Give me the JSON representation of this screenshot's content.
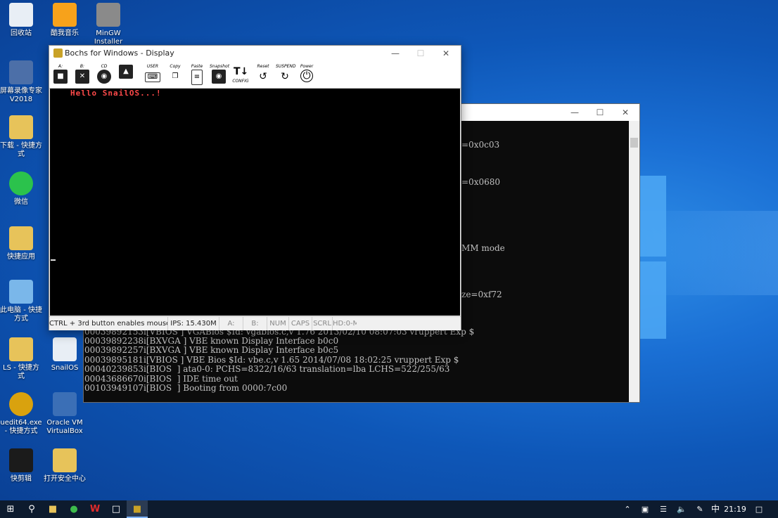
{
  "desktop_icons": [
    {
      "label": "回收站",
      "icon": "recycle-bin-icon"
    },
    {
      "label": "酷我音乐",
      "icon": "kuwo-music-icon"
    },
    {
      "label": "MinGW Installer",
      "icon": "mingw-installer-icon"
    },
    {
      "label": "屏幕录像专家 V2018",
      "icon": "screen-recorder-icon"
    },
    {
      "label": "下载 - 快捷方式",
      "icon": "folder-shortcut-icon"
    },
    {
      "label": "微信",
      "icon": "wechat-icon"
    },
    {
      "label": "快捷应用",
      "icon": "folder-shortcut-icon"
    },
    {
      "label": "此电脑 - 快捷方式",
      "icon": "this-pc-icon"
    },
    {
      "label": "LS - 快捷方式",
      "icon": "folder-shortcut-icon"
    },
    {
      "label": "SnailOS",
      "icon": "snailos-file-icon"
    },
    {
      "label": "uedit64.exe - 快捷方式",
      "icon": "ultraedit-icon"
    },
    {
      "label": "Oracle VM VirtualBox",
      "icon": "virtualbox-icon"
    },
    {
      "label": "快剪辑",
      "icon": "kuaijianji-icon"
    },
    {
      "label": "打开安全中心",
      "icon": "security-center-icon"
    }
  ],
  "console_window": {
    "partial_lines": [
      "=0x0c03",
      "=0x0680",
      "MM mode",
      "ze=0xf72"
    ],
    "log_lines": [
      "00039892153i[VBIOS ] VGABios $Id: vgabios.c,v 1.76 2013/02/10 08:07:03 vruppert Exp $",
      "00039892238i[BXVGA ] VBE known Display Interface b0c0",
      "00039892257i[BXVGA ] VBE known Display Interface b0c5",
      "00039895181i[VBIOS ] VBE Bios $Id: vbe.c,v 1.65 2014/07/08 18:02:25 vruppert Exp $",
      "00040239853i[BIOS  ] ata0-0: PCHS=8322/16/63 translation=lba LCHS=522/255/63",
      "00043686670i[BIOS  ] IDE time out",
      "00103949107i[BIOS  ] Booting from 0000:7c00"
    ]
  },
  "bochs": {
    "title": "Bochs for Windows - Display",
    "toolbar": [
      {
        "label": "A:",
        "icon": "floppy-a-icon"
      },
      {
        "label": "B:",
        "icon": "floppy-b-icon"
      },
      {
        "label": "CD",
        "icon": "cdrom-icon"
      },
      {
        "label": "",
        "icon": "mouse-toggle-icon"
      },
      {
        "label": "USER",
        "icon": "keyboard-icon"
      },
      {
        "label": "Copy",
        "icon": "copy-icon"
      },
      {
        "label": "Paste",
        "icon": "paste-icon"
      },
      {
        "label": "Snapshot",
        "icon": "snapshot-icon"
      },
      {
        "label": "CONFIG",
        "icon": "config-icon"
      },
      {
        "label": "Reset",
        "icon": "reset-icon"
      },
      {
        "label": "SUSPEND",
        "icon": "suspend-icon"
      },
      {
        "label": "Power",
        "icon": "power-icon"
      }
    ],
    "screen_text": "Hello SnailOS...!",
    "status": {
      "hint": "CTRL + 3rd button enables mouse",
      "ips": "IPS: 15.430M",
      "a": "A:",
      "b": "B:",
      "num": "NUM",
      "caps": "CAPS",
      "scrl": "SCRL",
      "hd": "HD:0-M"
    }
  },
  "taskbar": {
    "clock": "21:19",
    "ime": "中"
  }
}
